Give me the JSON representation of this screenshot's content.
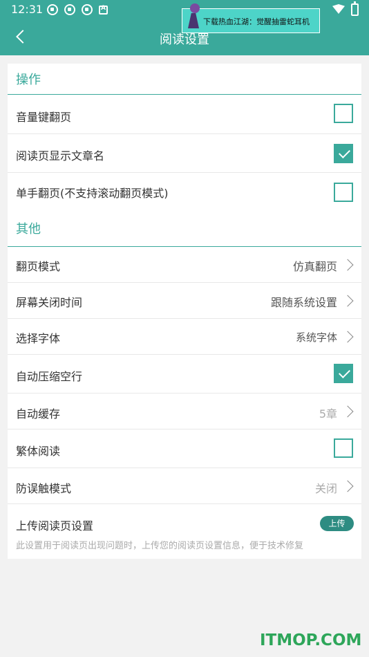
{
  "status_bar": {
    "time": "12:31"
  },
  "ad_banner": {
    "text": "下载热血江湖：觉醒抽雷蛇耳机"
  },
  "header": {
    "title": "阅读设置"
  },
  "colors": {
    "accent": "#3aa99b",
    "upload_button": "#2e8c82",
    "watermark": "#2ea65a"
  },
  "sections": [
    {
      "title": "操作"
    },
    {
      "title": "其他"
    }
  ],
  "operation_items": [
    {
      "label": "音量键翻页",
      "checked": false
    },
    {
      "label": "阅读页显示文章名",
      "checked": true
    },
    {
      "label": "单手翻页(不支持滚动翻页模式)",
      "checked": false
    }
  ],
  "other_items": [
    {
      "label": "翻页模式",
      "value": "仿真翻页"
    },
    {
      "label": "屏幕关闭时间",
      "value": "跟随系统设置"
    },
    {
      "label": "选择字体",
      "value": "系统字体"
    },
    {
      "label": "自动压缩空行",
      "checked": true
    },
    {
      "label": "自动缓存",
      "value": "5章"
    },
    {
      "label": "繁体阅读",
      "checked": false
    },
    {
      "label": "防误触模式",
      "value": "关闭"
    },
    {
      "label": "上传阅读页设置",
      "button": "上传",
      "description": "此设置用于阅读页出现问题时，上传您的阅读页设置信息，便于技术修复"
    }
  ],
  "watermark": "ITMOP.COM"
}
